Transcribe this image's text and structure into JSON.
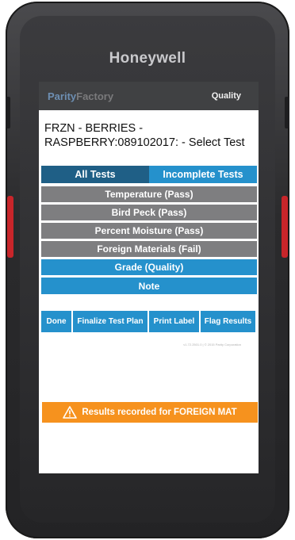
{
  "device": {
    "brand": "Honeywell"
  },
  "header": {
    "logo_part1": "Parity",
    "logo_part2": "Factory",
    "section": "Quality"
  },
  "title": "FRZN - BERRIES - RASPBERRY:089102017: - Select Test",
  "tabs": [
    {
      "label": "All Tests",
      "active": true
    },
    {
      "label": "Incomplete Tests",
      "active": false
    }
  ],
  "tests": [
    {
      "label": "Temperature (Pass)",
      "status": "pass"
    },
    {
      "label": "Bird Peck (Pass)",
      "status": "pass"
    },
    {
      "label": "Percent Moisture (Pass)",
      "status": "pass"
    },
    {
      "label": "Foreign Materials (Fail)",
      "status": "fail"
    },
    {
      "label": "Grade (Quality)",
      "status": "pending"
    },
    {
      "label": "Note",
      "status": "pending"
    }
  ],
  "actions": [
    "Done",
    "Finalize Test Plan",
    "Print Label",
    "Flag Results"
  ],
  "version": "v1.72.2501.0 | © 2015 Parity Corporation",
  "alert": {
    "icon": "warning-icon",
    "text": "Results recorded for FOREIGN MAT"
  },
  "colors": {
    "primary_blue": "#2591cc",
    "dark_blue": "#1f5f86",
    "gray": "#7e7e80",
    "alert_orange": "#f6921e"
  }
}
